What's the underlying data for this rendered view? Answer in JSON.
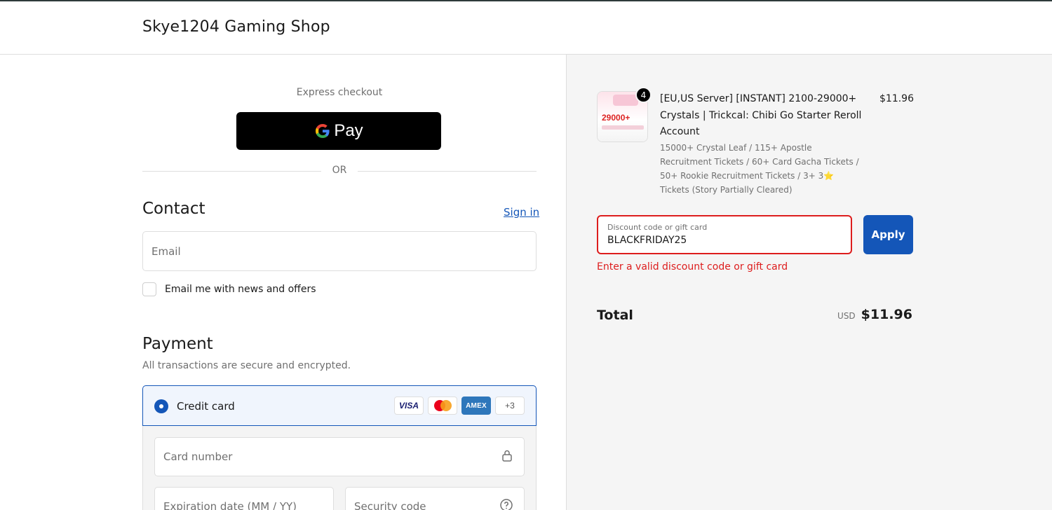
{
  "header": {
    "shop_name": "Skye1204 Gaming Shop"
  },
  "express_checkout": {
    "label": "Express checkout",
    "gpay_label": "Pay",
    "or_text": "OR"
  },
  "contact": {
    "title": "Contact",
    "sign_in": "Sign in",
    "email_placeholder": "Email",
    "email_value": "",
    "newsletter_label": "Email me with news and offers",
    "newsletter_checked": false
  },
  "payment": {
    "title": "Payment",
    "subtitle": "All transactions are secure and encrypted.",
    "method_label": "Credit card",
    "card_brands": [
      "VISA",
      "Mastercard",
      "AMEX",
      "+3"
    ],
    "card_number_placeholder": "Card number",
    "expiration_placeholder": "Expiration date (MM / YY)",
    "security_code_placeholder": "Security code"
  },
  "order": {
    "item": {
      "quantity": "4",
      "title": "[EU,US Server] [INSTANT] 2100-29000+ Crystals | Trickcal: Chibi Go Starter Reroll Account",
      "description": "15000+ Crystal Leaf / 115+ Apostle Recruitment Tickets / 60+ Card Gacha Tickets / 50+ Rookie Recruitment Tickets / 3+ 3⭐ Tickets (Story Partially Cleared)",
      "price": "$11.96",
      "thumb_text": "29000+"
    },
    "discount": {
      "label": "Discount code or gift card",
      "value": "BLACKFRIDAY25",
      "apply_label": "Apply",
      "error": "Enter a valid discount code or gift card"
    },
    "total": {
      "label": "Total",
      "currency": "USD",
      "amount": "$11.96"
    }
  },
  "colors": {
    "accent": "#1456b8",
    "error": "#dd1d1d",
    "summary_bg": "#f5f5f5"
  }
}
